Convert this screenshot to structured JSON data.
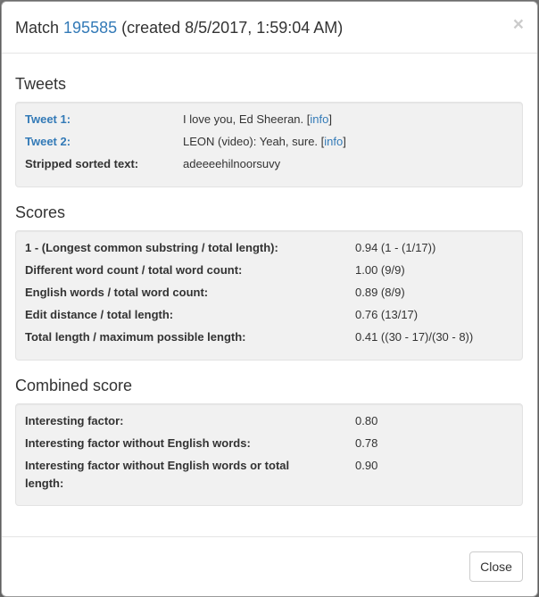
{
  "modal": {
    "title_prefix": "Match ",
    "match_id": "195585",
    "title_suffix": " (created 8/5/2017, 1:59:04 AM)",
    "close_glyph": "×"
  },
  "tweets": {
    "heading": "Tweets",
    "tweet1_label": "Tweet 1:",
    "tweet1_text": "I love you, Ed Sheeran. ",
    "tweet2_label": "Tweet 2:",
    "tweet2_text": "LEON (video): Yeah, sure. ",
    "info_link": "info",
    "bracket_open": "[",
    "bracket_close": "]",
    "stripped_label": "Stripped sorted text:",
    "stripped_value": "adeeeehilnoorsuvy"
  },
  "scores": {
    "heading": "Scores",
    "rows": [
      {
        "label": "1 - (Longest common substring / total length):",
        "value": "0.94 (1 - (1/17))"
      },
      {
        "label": "Different word count / total word count:",
        "value": "1.00 (9/9)"
      },
      {
        "label": "English words / total word count:",
        "value": "0.89 (8/9)"
      },
      {
        "label": "Edit distance / total length:",
        "value": "0.76 (13/17)"
      },
      {
        "label": "Total length / maximum possible length:",
        "value": "0.41 ((30 - 17)/(30 - 8))"
      }
    ]
  },
  "combined": {
    "heading": "Combined score",
    "rows": [
      {
        "label": "Interesting factor:",
        "value": "0.80"
      },
      {
        "label": "Interesting factor without English words:",
        "value": "0.78"
      },
      {
        "label": "Interesting factor without English words or total",
        "label2": "length:",
        "value": "0.90"
      }
    ]
  },
  "footer": {
    "close_label": "Close"
  }
}
